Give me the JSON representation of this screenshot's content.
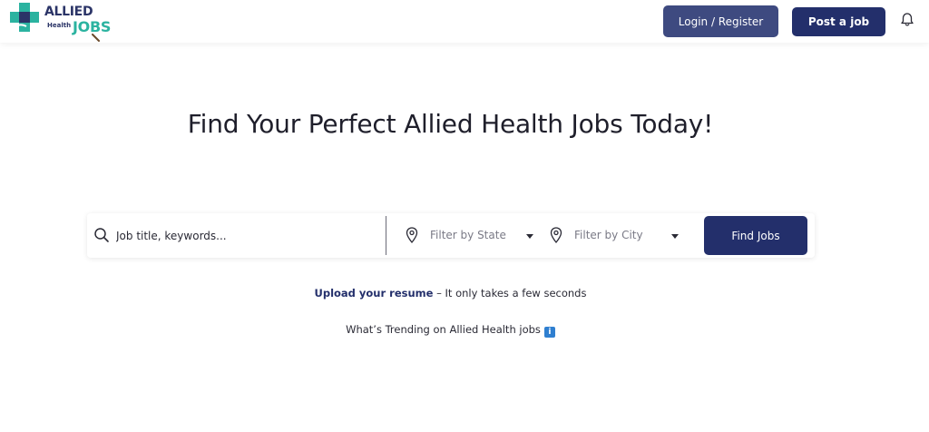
{
  "header": {
    "logo": {
      "line1": "ALLIED",
      "line2": "Health",
      "line3": "JOBS"
    },
    "login_label": "Login / Register",
    "post_job_label": "Post a job",
    "notification_icon": "bell-icon"
  },
  "hero": {
    "title": "Find Your Perfect Allied Health Jobs Today!"
  },
  "search": {
    "keyword_placeholder": "Job title, keywords...",
    "keyword_value": "",
    "state_filter": "Filter by State",
    "city_filter": "Filter by City",
    "find_label": "Find Jobs",
    "icons": {
      "search": "search-icon",
      "location": "location-pin-icon",
      "dropdown": "caret-down-icon"
    }
  },
  "upload": {
    "link_text": "Upload your resume",
    "rest_text": " – It only takes a few seconds"
  },
  "trending": {
    "text": "What’s Trending on Allied Health jobs",
    "icon_glyph": "i"
  },
  "colors": {
    "primary": "#232f6b",
    "login_button": "#3e4a80",
    "accent_teal": "#2bb3a0",
    "info_blue": "#2f7fd0"
  }
}
